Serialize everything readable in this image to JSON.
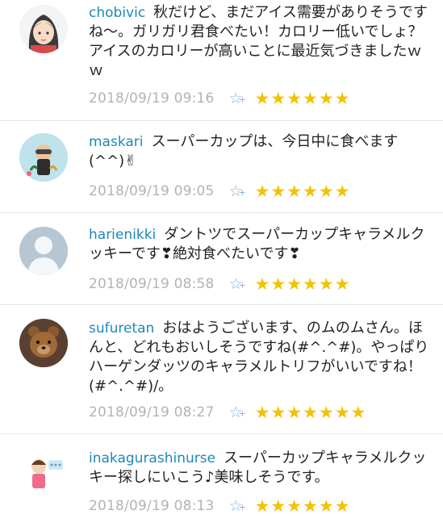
{
  "comments": [
    {
      "user": "chobivic",
      "text": "秋だけど、まだアイス需要がありそうですね～。ガリガリ君食べたい！カロリー低いでしょ？アイスのカロリーが高いことに最近気づきましたｗｗ",
      "time": "2018/09/19 09:16",
      "stars": "★★★★★★",
      "avatar": "girl-illustration"
    },
    {
      "user": "maskari",
      "text": "スーパーカップは、今日中に食べます(^^)✌",
      "time": "2018/09/19 09:05",
      "stars": "★★★★★★",
      "avatar": "diver-illustration"
    },
    {
      "user": "harienikki",
      "text": "ダントツでスーパーカップキャラメルクッキーです❣絶対食べたいです❣",
      "time": "2018/09/19 08:58",
      "stars": "★★★★★★",
      "avatar": "default-user"
    },
    {
      "user": "sufuretan",
      "text": "おはようございます、のムのムさん。ほんと、どれもおいしそうですね(#^.^#)。やっぱりハーゲンダッツのキャラメルトリフがいいですね！　(#^.^#)/。",
      "time": "2018/09/19 08:27",
      "stars": "★★★★★★★",
      "avatar": "teddy-bear-photo"
    },
    {
      "user": "inakagurashinurse",
      "text": "スーパーカップキャラメルクッキー探しにいこう♪美味しそうです。",
      "time": "2018/09/19 08:13",
      "stars": "★★★★★★",
      "avatar": "nurse-illustration"
    }
  ],
  "icons": {
    "favorite": "star-outline-plus-icon"
  },
  "colors": {
    "username": "#1e88b8",
    "timestamp": "#b3b3b3",
    "star": "#f2c200",
    "favorite": "#8ab0d8"
  }
}
